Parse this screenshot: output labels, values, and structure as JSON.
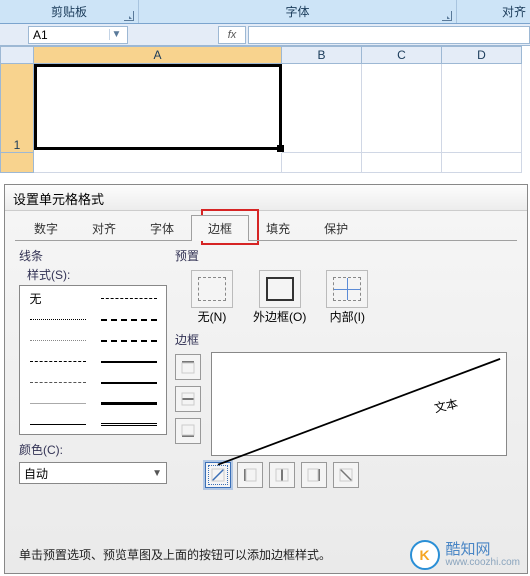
{
  "ribbon": {
    "groups": [
      "剪贴板",
      "字体",
      "对齐"
    ],
    "expand_partial": "对齐"
  },
  "namebox": {
    "value": "A1",
    "fx": "fx"
  },
  "grid": {
    "cols": [
      "A",
      "B",
      "C",
      "D"
    ],
    "row1": "1"
  },
  "dialog": {
    "title": "设置单元格格式",
    "tabs": [
      "数字",
      "对齐",
      "字体",
      "边框",
      "填充",
      "保护"
    ],
    "active_tab": 3,
    "line_section": "线条",
    "style_label": "样式(S):",
    "style_none": "无",
    "color_label": "颜色(C):",
    "color_value": "自动",
    "preset_section": "预置",
    "presets": [
      {
        "label": "无(N)"
      },
      {
        "label": "外边框(O)"
      },
      {
        "label": "内部(I)"
      }
    ],
    "border_section": "边框",
    "preview_text": "文本",
    "hint": "单击预置选项、预览草图及上面的按钮可以添加边框样式。"
  },
  "watermark": {
    "logo": "K",
    "name": "酷知网",
    "url": "www.coozhi.com"
  }
}
